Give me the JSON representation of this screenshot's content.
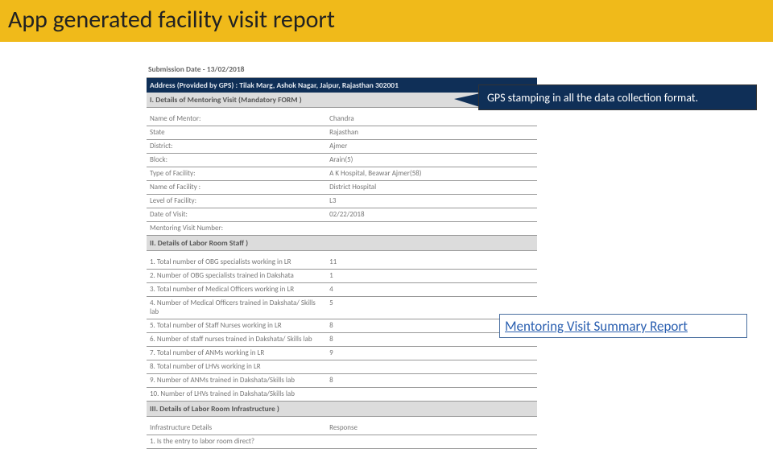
{
  "title": "App generated facility visit report",
  "submission_label": "Submission Date -",
  "submission_date": "13/02/2018",
  "address_label": "Address (Provided by GPS) :",
  "address_value": "Tilak Marg, Ashok Nagar, Jaipur, Rajasthan 302001",
  "section1_title": "I. Details of Mentoring Visit (Mandatory FORM )",
  "section2_title": "II. Details of Labor Room Staff )",
  "section3_title": "III. Details of Labor Room Infrastructure )",
  "callout_text": "GPS stamping in all the data collection format.",
  "link_text": "Mentoring Visit Summary Report",
  "s1": {
    "r0": {
      "l": "Name of Mentor:",
      "v": "Chandra"
    },
    "r1": {
      "l": "State",
      "v": "Rajasthan"
    },
    "r2": {
      "l": "District:",
      "v": "Ajmer"
    },
    "r3": {
      "l": "Block:",
      "v": "Arain(5)"
    },
    "r4": {
      "l": "Type of Facility:",
      "v": "A K Hospital, Beawar Ajmer(58)"
    },
    "r5": {
      "l": "Name of Facility :",
      "v": "District Hospital"
    },
    "r6": {
      "l": "Level of Facility:",
      "v": "L3"
    },
    "r7": {
      "l": "Date of Visit:",
      "v": "02/22/2018"
    },
    "r8": {
      "l": "Mentoring Visit Number:",
      "v": ""
    }
  },
  "s2": {
    "r0": {
      "l": "1. Total number of OBG specialists working in LR",
      "v": "11"
    },
    "r1": {
      "l": "2. Number of OBG specialists trained in Dakshata",
      "v": "1"
    },
    "r2": {
      "l": "3. Total number of Medical Officers working in LR",
      "v": "4"
    },
    "r3": {
      "l": "4. Number of Medical Officers trained in Dakshata/ Skills lab",
      "v": "5"
    },
    "r4": {
      "l": "5. Total number of Staff Nurses working in LR",
      "v": "8"
    },
    "r5": {
      "l": "6. Number of staff nurses trained in Dakshata/ Skills lab",
      "v": "8"
    },
    "r6": {
      "l": "7. Total number of ANMs working in LR",
      "v": "9"
    },
    "r7": {
      "l": "8. Total number of LHVs working in LR",
      "v": ""
    },
    "r8": {
      "l": "9. Number of ANMs trained in Dakshata/Skills lab",
      "v": "8"
    },
    "r9": {
      "l": "10. Number of LHVs trained in Dakshata/Skills lab",
      "v": ""
    }
  },
  "s3": {
    "hdr_l": "Infrastructure Details",
    "hdr_v": "Response",
    "r0": {
      "l": "1. Is the entry to labor room direct?",
      "v": ""
    }
  }
}
